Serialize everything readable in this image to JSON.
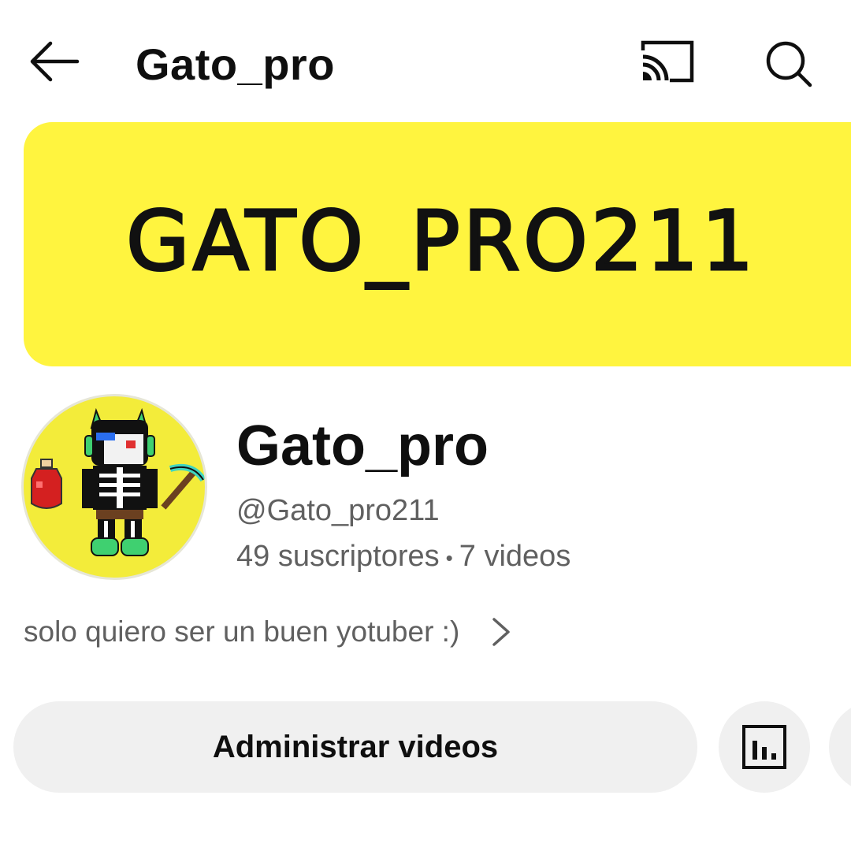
{
  "header": {
    "title": "Gato_pro",
    "icons": [
      "back-arrow-icon",
      "cast-icon",
      "search-icon"
    ]
  },
  "banner": {
    "text": "GATO_PRO211",
    "background_color": "#fff43f"
  },
  "channel": {
    "name": "Gato_pro",
    "handle": "@Gato_pro211",
    "subscribers": "49 suscriptores",
    "separator": "•",
    "videos": "7 videos",
    "description": "solo quiero ser un buen yotuber :)",
    "avatar_background": "#f3ec3a"
  },
  "actions": {
    "manage_videos_label": "Administrar videos",
    "icons": [
      "analytics-icon"
    ]
  }
}
